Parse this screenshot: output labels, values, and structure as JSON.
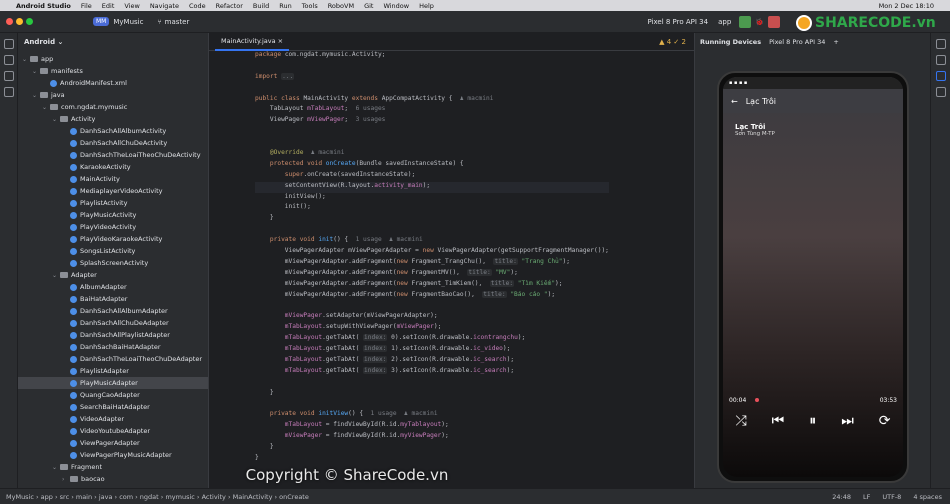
{
  "macbar": {
    "app": "Android Studio",
    "menus": [
      "File",
      "Edit",
      "View",
      "Navigate",
      "Code",
      "Refactor",
      "Build",
      "Run",
      "Tools",
      "RoboVM",
      "Git",
      "Window",
      "Help"
    ],
    "clock": "Mon 2 Dec 18:10"
  },
  "toolbar": {
    "project_badge": "MM",
    "project": "MyMusic",
    "branch": "master",
    "device": "Pixel 8 Pro API 34",
    "run_config": "app"
  },
  "project_panel": {
    "title": "Android"
  },
  "tree": [
    {
      "label": "app",
      "depth": 0,
      "type": "dir",
      "open": true
    },
    {
      "label": "manifests",
      "depth": 1,
      "type": "dir",
      "open": true
    },
    {
      "label": "AndroidManifest.xml",
      "depth": 2,
      "type": "file"
    },
    {
      "label": "java",
      "depth": 1,
      "type": "dir",
      "open": true
    },
    {
      "label": "com.ngdat.mymusic",
      "depth": 2,
      "type": "dir",
      "open": true
    },
    {
      "label": "Activity",
      "depth": 3,
      "type": "dir",
      "open": true
    },
    {
      "label": "DanhSachAllAlbumActivity",
      "depth": 4,
      "type": "file"
    },
    {
      "label": "DanhSachAllChuDeActivity",
      "depth": 4,
      "type": "file"
    },
    {
      "label": "DanhSachTheLoaiTheoChuDeActivity",
      "depth": 4,
      "type": "file"
    },
    {
      "label": "KaraokeActivity",
      "depth": 4,
      "type": "file"
    },
    {
      "label": "MainActivity",
      "depth": 4,
      "type": "file"
    },
    {
      "label": "MediaplayerVideoActivity",
      "depth": 4,
      "type": "file"
    },
    {
      "label": "PlaylistActivity",
      "depth": 4,
      "type": "file"
    },
    {
      "label": "PlayMusicActivity",
      "depth": 4,
      "type": "file"
    },
    {
      "label": "PlayVideoActivity",
      "depth": 4,
      "type": "file"
    },
    {
      "label": "PlayVideoKaraokeActivity",
      "depth": 4,
      "type": "file"
    },
    {
      "label": "SongsListActivity",
      "depth": 4,
      "type": "file"
    },
    {
      "label": "SplashScreenActivity",
      "depth": 4,
      "type": "file"
    },
    {
      "label": "Adapter",
      "depth": 3,
      "type": "dir",
      "open": true
    },
    {
      "label": "AlbumAdapter",
      "depth": 4,
      "type": "file"
    },
    {
      "label": "BaiHatAdapter",
      "depth": 4,
      "type": "file"
    },
    {
      "label": "DanhSachAllAlbumAdapter",
      "depth": 4,
      "type": "file"
    },
    {
      "label": "DanhSachAllChuDeAdapter",
      "depth": 4,
      "type": "file"
    },
    {
      "label": "DanhSachAllPlaylistAdapter",
      "depth": 4,
      "type": "file"
    },
    {
      "label": "DanhSachBaiHatAdapter",
      "depth": 4,
      "type": "file"
    },
    {
      "label": "DanhSachTheLoaiTheoChuDeAdapter",
      "depth": 4,
      "type": "file"
    },
    {
      "label": "PlaylistAdapter",
      "depth": 4,
      "type": "file"
    },
    {
      "label": "PlayMusicAdapter",
      "depth": 4,
      "type": "file",
      "selected": true
    },
    {
      "label": "QuangCaoAdapter",
      "depth": 4,
      "type": "file"
    },
    {
      "label": "SearchBaiHatAdapter",
      "depth": 4,
      "type": "file"
    },
    {
      "label": "VideoAdapter",
      "depth": 4,
      "type": "file"
    },
    {
      "label": "VideoYoutubeAdapter",
      "depth": 4,
      "type": "file"
    },
    {
      "label": "ViewPagerAdapter",
      "depth": 4,
      "type": "file"
    },
    {
      "label": "ViewPagerPlayMusicAdapter",
      "depth": 4,
      "type": "file"
    },
    {
      "label": "Fragment",
      "depth": 3,
      "type": "dir",
      "open": true
    },
    {
      "label": "baocao",
      "depth": 4,
      "type": "dir",
      "open": false
    }
  ],
  "editor": {
    "tab": "MainActivity.java",
    "warnings": "4",
    "checks": "2",
    "lines": [
      [
        {
          "t": "package ",
          "c": "kw"
        },
        {
          "t": "com.ngdat.mymusic.Activity;",
          "c": "cls"
        }
      ],
      [],
      [
        {
          "t": "import ",
          "c": "kw"
        },
        {
          "t": "...",
          "c": "hint"
        }
      ],
      [],
      [
        {
          "t": "public class ",
          "c": "kw"
        },
        {
          "t": "MainActivity ",
          "c": "cls"
        },
        {
          "t": "extends ",
          "c": "kw"
        },
        {
          "t": "AppCompatActivity {  ",
          "c": "cls"
        },
        {
          "t": "♟ macmini",
          "c": "cm"
        }
      ],
      [
        {
          "t": "    TabLayout ",
          "c": "cls"
        },
        {
          "t": "mTabLayout",
          "c": "fld"
        },
        {
          "t": ";  ",
          "c": "cls"
        },
        {
          "t": "6 usages",
          "c": "cm"
        }
      ],
      [
        {
          "t": "    ViewPager ",
          "c": "cls"
        },
        {
          "t": "mViewPager",
          "c": "fld"
        },
        {
          "t": ";  ",
          "c": "cls"
        },
        {
          "t": "3 usages",
          "c": "cm"
        }
      ],
      [],
      [],
      [
        {
          "t": "    @Override  ",
          "c": "ann"
        },
        {
          "t": "♟ macmini",
          "c": "cm"
        }
      ],
      [
        {
          "t": "    protected void ",
          "c": "kw"
        },
        {
          "t": "onCreate",
          "c": "mth"
        },
        {
          "t": "(Bundle savedInstanceState) {",
          "c": "cls"
        }
      ],
      [
        {
          "t": "        super",
          "c": "kw"
        },
        {
          "t": ".onCreate(savedInstanceState);",
          "c": "cls"
        }
      ],
      [
        {
          "t": "        setContentView(R.layout.",
          "c": "cls"
        },
        {
          "t": "activity_main",
          "c": "fld"
        },
        {
          "t": ");",
          "c": "cls"
        }
      ],
      [
        {
          "t": "        initView();",
          "c": "cls"
        }
      ],
      [
        {
          "t": "        init();",
          "c": "cls"
        }
      ],
      [
        {
          "t": "    }",
          "c": "cls"
        }
      ],
      [],
      [
        {
          "t": "    private void ",
          "c": "kw"
        },
        {
          "t": "init",
          "c": "mth"
        },
        {
          "t": "() {  ",
          "c": "cls"
        },
        {
          "t": "1 usage  ♟ macmini",
          "c": "cm"
        }
      ],
      [
        {
          "t": "        ViewPagerAdapter mViewPagerAdapter = ",
          "c": "cls"
        },
        {
          "t": "new ",
          "c": "kw"
        },
        {
          "t": "ViewPagerAdapter(getSupportFragmentManager());",
          "c": "cls"
        }
      ],
      [
        {
          "t": "        mViewPagerAdapter.addFragment(",
          "c": "cls"
        },
        {
          "t": "new ",
          "c": "kw"
        },
        {
          "t": "Fragment_TrangChu(),  ",
          "c": "cls"
        },
        {
          "t": "title:",
          "c": "hint"
        },
        {
          "t": " \"Trang Chủ\"",
          "c": "str"
        },
        {
          "t": ");",
          "c": "cls"
        }
      ],
      [
        {
          "t": "        mViewPagerAdapter.addFragment(",
          "c": "cls"
        },
        {
          "t": "new ",
          "c": "kw"
        },
        {
          "t": "FragmentMV(),  ",
          "c": "cls"
        },
        {
          "t": "title:",
          "c": "hint"
        },
        {
          "t": " \"MV\"",
          "c": "str"
        },
        {
          "t": ");",
          "c": "cls"
        }
      ],
      [
        {
          "t": "        mViewPagerAdapter.addFragment(",
          "c": "cls"
        },
        {
          "t": "new ",
          "c": "kw"
        },
        {
          "t": "Fragment_TimKiem(),  ",
          "c": "cls"
        },
        {
          "t": "title:",
          "c": "hint"
        },
        {
          "t": " \"Tìm Kiếm\"",
          "c": "str"
        },
        {
          "t": ");",
          "c": "cls"
        }
      ],
      [
        {
          "t": "        mViewPagerAdapter.addFragment(",
          "c": "cls"
        },
        {
          "t": "new ",
          "c": "kw"
        },
        {
          "t": "FragmentBaoCao(),  ",
          "c": "cls"
        },
        {
          "t": "title:",
          "c": "hint"
        },
        {
          "t": " \"Báo cáo \"",
          "c": "str"
        },
        {
          "t": ");",
          "c": "cls"
        }
      ],
      [],
      [
        {
          "t": "        mViewPager",
          "c": "fld"
        },
        {
          "t": ".setAdapter(mViewPagerAdapter);",
          "c": "cls"
        }
      ],
      [
        {
          "t": "        mTabLayout",
          "c": "fld"
        },
        {
          "t": ".setupWithViewPager(",
          "c": "cls"
        },
        {
          "t": "mViewPager",
          "c": "fld"
        },
        {
          "t": ");",
          "c": "cls"
        }
      ],
      [
        {
          "t": "        mTabLayout",
          "c": "fld"
        },
        {
          "t": ".getTabAt( ",
          "c": "cls"
        },
        {
          "t": "index:",
          "c": "hint"
        },
        {
          "t": " 0).setIcon(R.drawable.",
          "c": "cls"
        },
        {
          "t": "icontrangchu",
          "c": "fld"
        },
        {
          "t": ");",
          "c": "cls"
        }
      ],
      [
        {
          "t": "        mTabLayout",
          "c": "fld"
        },
        {
          "t": ".getTabAt( ",
          "c": "cls"
        },
        {
          "t": "index:",
          "c": "hint"
        },
        {
          "t": " 1).setIcon(R.drawable.",
          "c": "cls"
        },
        {
          "t": "ic_video",
          "c": "fld"
        },
        {
          "t": ");",
          "c": "cls"
        }
      ],
      [
        {
          "t": "        mTabLayout",
          "c": "fld"
        },
        {
          "t": ".getTabAt( ",
          "c": "cls"
        },
        {
          "t": "index:",
          "c": "hint"
        },
        {
          "t": " 2).setIcon(R.drawable.",
          "c": "cls"
        },
        {
          "t": "ic_search",
          "c": "fld"
        },
        {
          "t": ");",
          "c": "cls"
        }
      ],
      [
        {
          "t": "        mTabLayout",
          "c": "fld"
        },
        {
          "t": ".getTabAt( ",
          "c": "cls"
        },
        {
          "t": "index:",
          "c": "hint"
        },
        {
          "t": " 3).setIcon(R.drawable.",
          "c": "cls"
        },
        {
          "t": "ic_search",
          "c": "fld"
        },
        {
          "t": ");",
          "c": "cls"
        }
      ],
      [],
      [
        {
          "t": "    }",
          "c": "cls"
        }
      ],
      [],
      [
        {
          "t": "    private void ",
          "c": "kw"
        },
        {
          "t": "initView",
          "c": "mth"
        },
        {
          "t": "() {  ",
          "c": "cls"
        },
        {
          "t": "1 usage  ♟ macmini",
          "c": "cm"
        }
      ],
      [
        {
          "t": "        mTabLayout ",
          "c": "fld"
        },
        {
          "t": "= findViewById(R.id.",
          "c": "cls"
        },
        {
          "t": "myTablayout",
          "c": "fld"
        },
        {
          "t": ");",
          "c": "cls"
        }
      ],
      [
        {
          "t": "        mViewPager ",
          "c": "fld"
        },
        {
          "t": "= findViewById(R.id.",
          "c": "cls"
        },
        {
          "t": "myViewPager",
          "c": "fld"
        },
        {
          "t": ");",
          "c": "cls"
        }
      ],
      [
        {
          "t": "    }",
          "c": "cls"
        }
      ],
      [
        {
          "t": "}",
          "c": "cls"
        }
      ]
    ]
  },
  "emulator": {
    "tab_running": "Running Devices",
    "tab_device": "Pixel 8 Pro API 34",
    "screen_title": "Lạc Trôi",
    "song_title": "Lạc Trôi",
    "song_artist": "Sơn Tùng M-TP",
    "time_current": "00:04",
    "time_total": "03:53",
    "progress": 0.02
  },
  "statusbar": {
    "breadcrumb": [
      "MyMusic",
      "app",
      "src",
      "main",
      "java",
      "com",
      "ngdat",
      "mymusic",
      "Activity",
      "MainActivity",
      "onCreate"
    ],
    "position": "24:48",
    "line_sep": "LF",
    "encoding": "UTF-8",
    "indent": "4 spaces"
  },
  "watermark": "Copyright © ShareCode.vn",
  "watermark_small": "ShareCode.vn",
  "logo": "SHARECODE.vn"
}
